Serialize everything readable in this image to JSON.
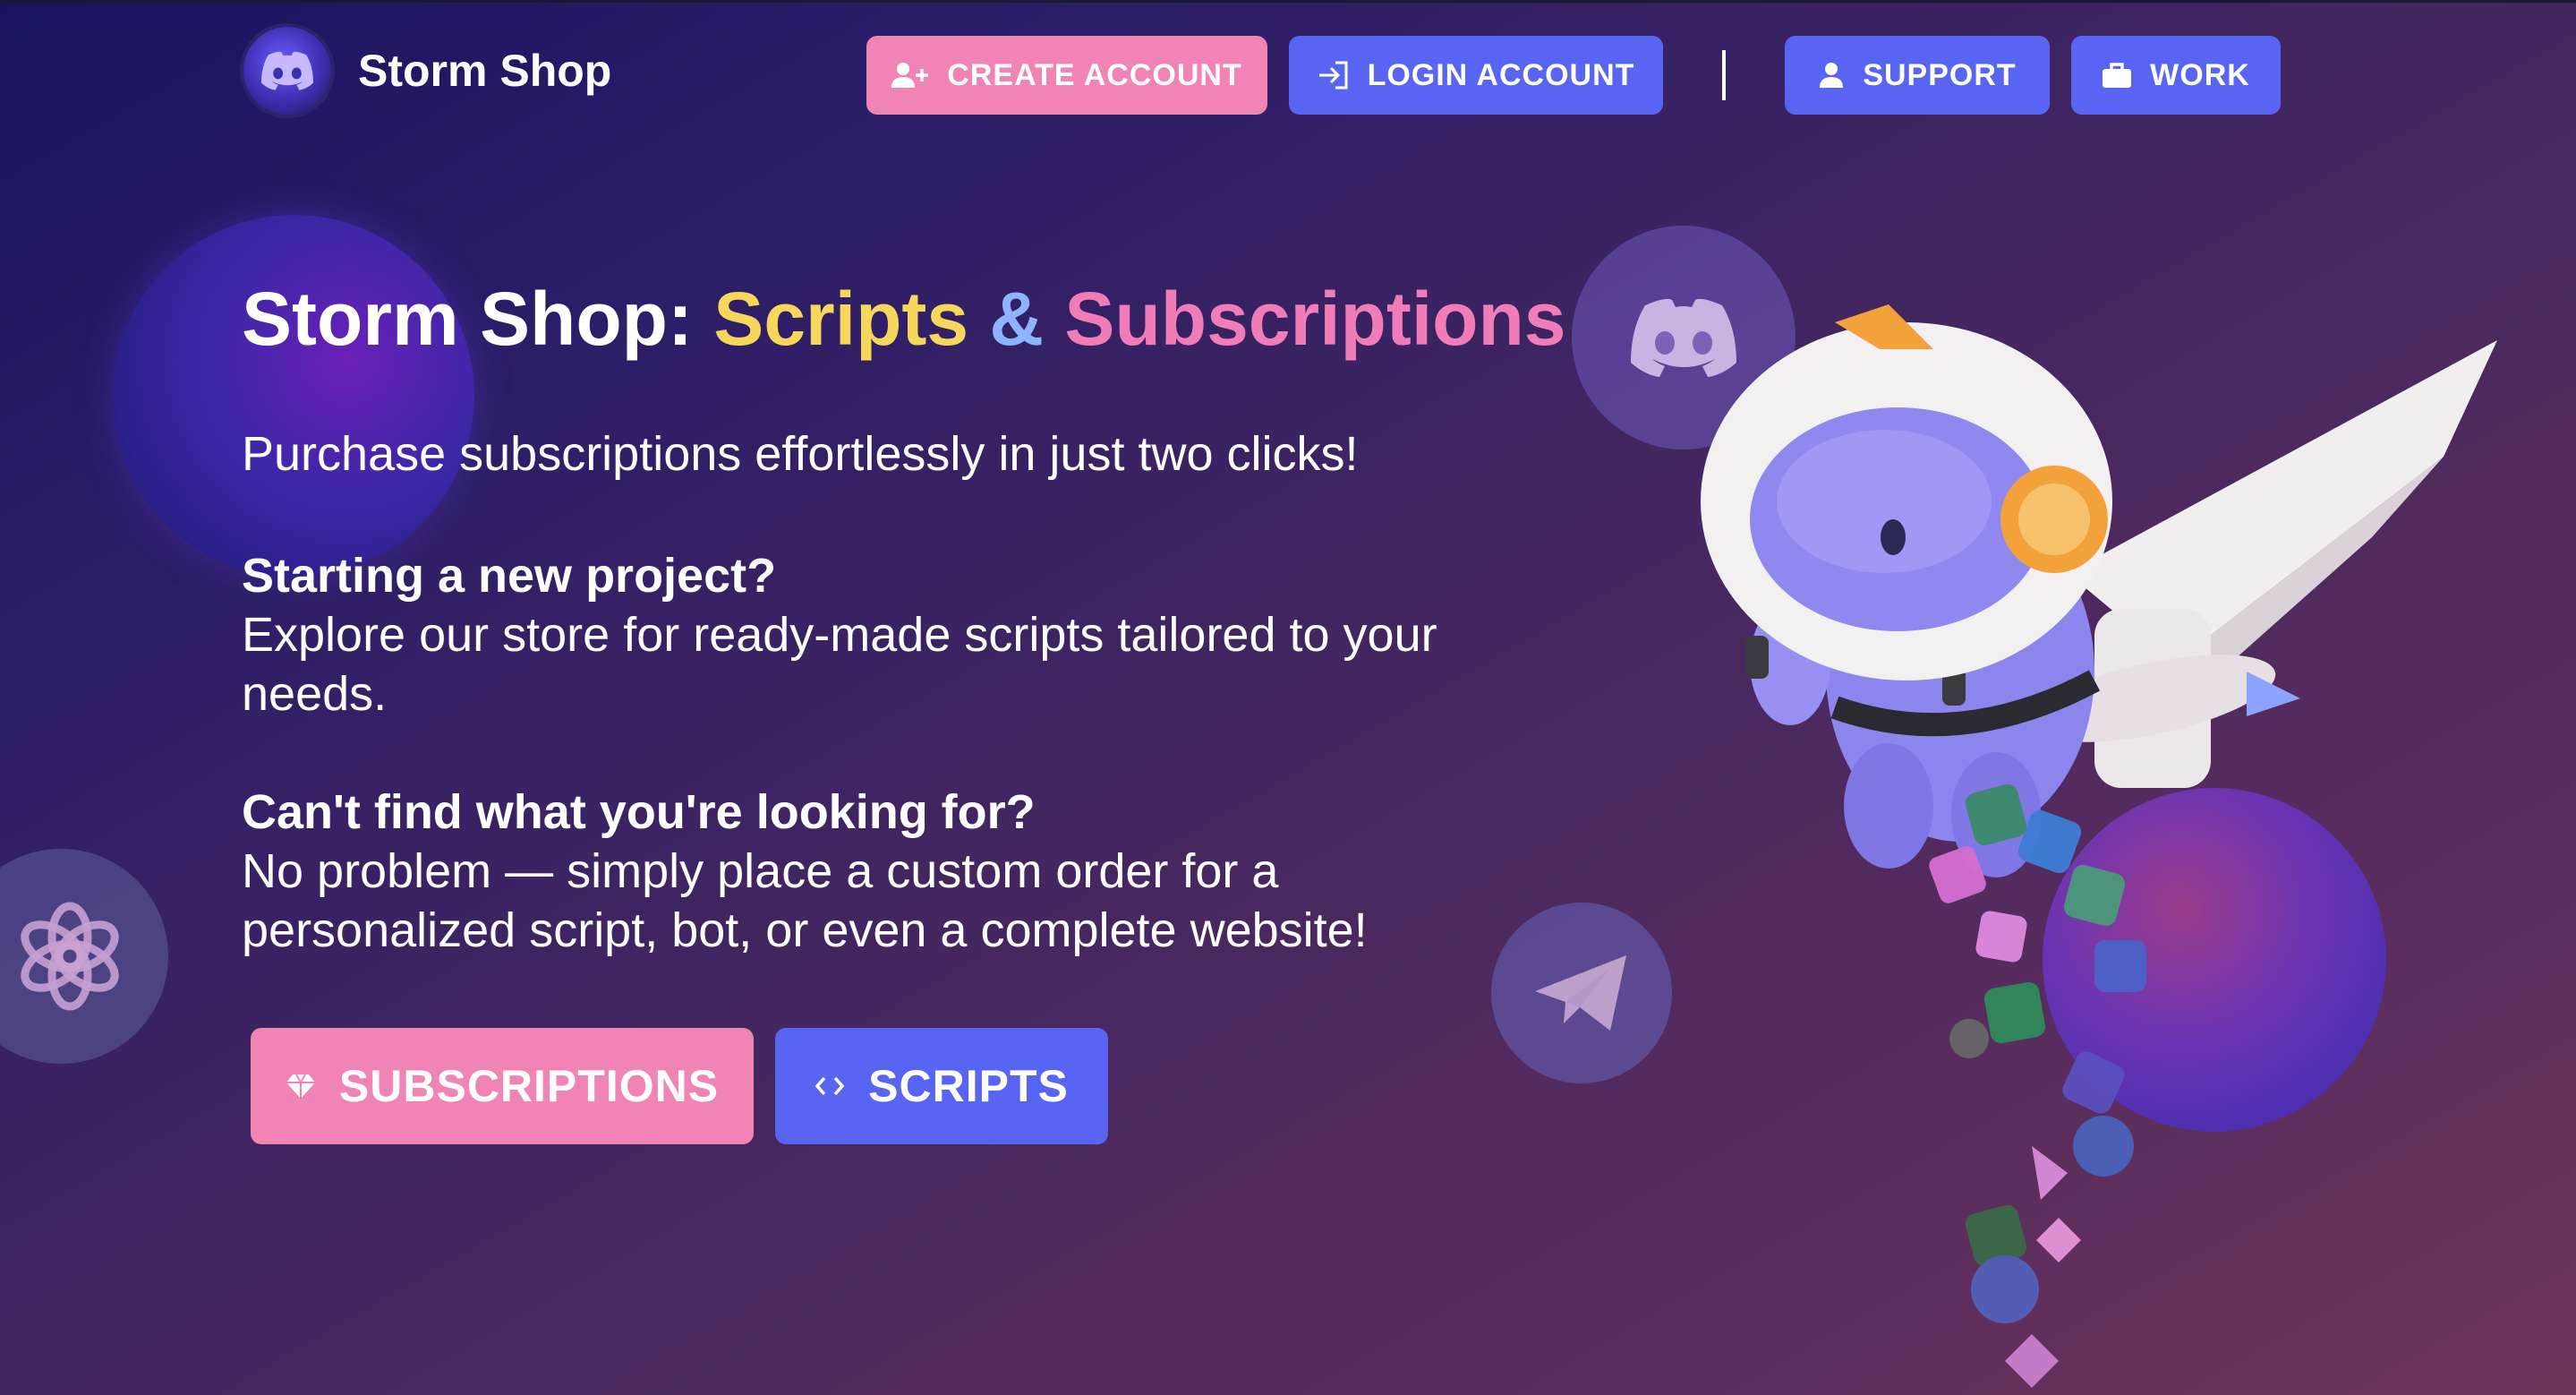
{
  "brand": {
    "name": "Storm Shop"
  },
  "nav": {
    "create_account": "CREATE ACCOUNT",
    "login_account": "LOGIN ACCOUNT",
    "divider": "|",
    "support": "SUPPORT",
    "work": "WORK"
  },
  "hero": {
    "title_prefix": "Storm Shop: ",
    "title_scripts": "Scripts",
    "title_amp": " & ",
    "title_subscriptions": "Subscriptions",
    "lead": "Purchase subscriptions effortlessly in just two clicks!",
    "q1_heading": "Starting a new project?",
    "q1_body": "Explore our store for ready-made scripts tailored to your needs.",
    "q2_heading": "Can't find what you're looking for?",
    "q2_body": "No problem — simply place a custom order for a personalized script, bot, or even a complete website!"
  },
  "cta": {
    "subscriptions": "SUBSCRIPTIONS",
    "scripts": "SCRIPTS"
  },
  "icons": [
    "discord-logo-icon",
    "add-user-icon",
    "login-icon",
    "user-icon",
    "briefcase-icon",
    "discord-icon",
    "telegram-icon",
    "openai-icon",
    "gem-icon",
    "code-icon"
  ],
  "colors": {
    "pink_button": "#f084b4",
    "blue_button": "#5865f2",
    "title_yellow": "#f7d65c",
    "title_pink": "#f07db8",
    "title_ampersand": "#8fb4ff"
  }
}
